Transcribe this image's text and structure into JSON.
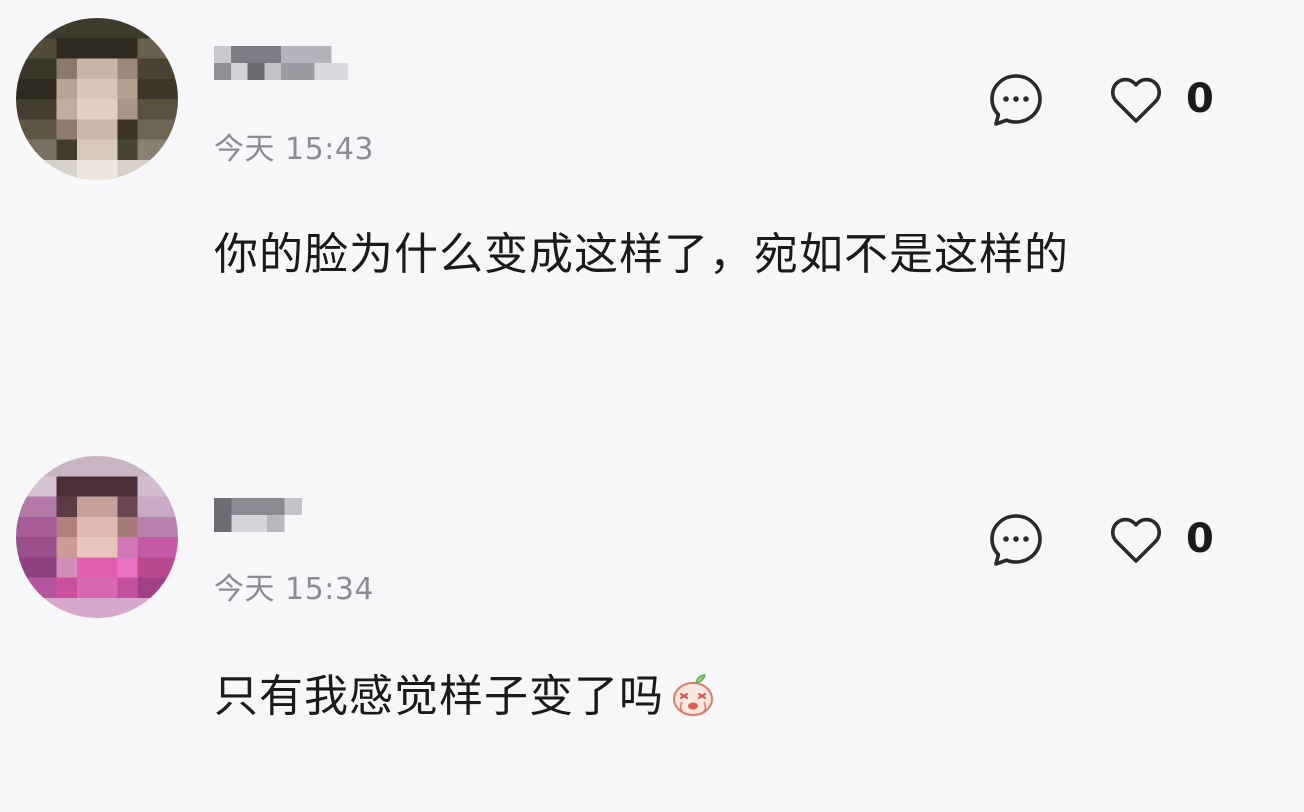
{
  "comments": [
    {
      "timestamp": "今天 15:43",
      "text": "你的脸为什么变成这样了，宛如不是这样的",
      "likes": "0",
      "avatar_icon": "pixelated-avatar",
      "username_icon": "pixelated-username"
    },
    {
      "timestamp": "今天 15:34",
      "text": "只有我感觉样子变了吗",
      "likes": "0",
      "avatar_icon": "pixelated-avatar",
      "username_icon": "pixelated-username",
      "emoji_icon": "crying-face-emoji-icon"
    }
  ],
  "colors": {
    "background": "#f7f7fa",
    "text": "#1a1a1a",
    "timestamp": "#8c8c96",
    "icon_stroke": "#2a2a2a"
  }
}
